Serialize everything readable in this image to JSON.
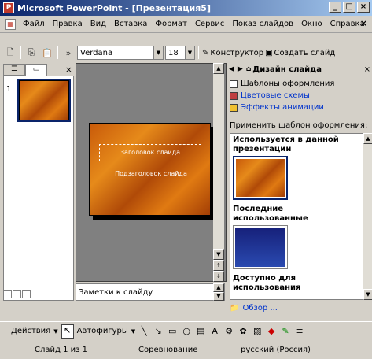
{
  "window": {
    "title": "Microsoft PowerPoint - [Презентация5]",
    "app_icon": "powerpoint-icon",
    "buttons": {
      "minimize": "_",
      "maximize": "□",
      "close": "×"
    }
  },
  "menu": {
    "items": [
      "Файл",
      "Правка",
      "Вид",
      "Вставка",
      "Формат",
      "Сервис",
      "Показ слайдов",
      "Окно",
      "Справка"
    ],
    "close": "×"
  },
  "toolbar": {
    "font_name": "Verdana",
    "font_size": "18",
    "constructor_label": "Конструктор",
    "new_slide_label": "Создать слайд"
  },
  "left_panel": {
    "close": "×",
    "slide_number": "1"
  },
  "slide": {
    "title_placeholder": "Заголовок слайда",
    "subtitle_placeholder": "Подзаголовок слайда"
  },
  "notes": {
    "placeholder": "Заметки к слайду"
  },
  "task_pane": {
    "title": "Дизайн слайда",
    "close": "×",
    "links": {
      "templates": "Шаблоны оформления",
      "color_schemes": "Цветовые схемы",
      "animation": "Эффекты анимации"
    },
    "apply_label": "Применить шаблон оформления:",
    "sections": {
      "used": "Используется в данной презентации",
      "recent": "Последние использованные",
      "available": "Доступно для использования"
    },
    "browse": "Обзор ..."
  },
  "draw_toolbar": {
    "actions": "Действия",
    "autoshapes": "Автофигуры"
  },
  "status": {
    "slide": "Слайд 1 из 1",
    "design": "Соревнование",
    "language": "русский (Россия)"
  },
  "colors": {
    "title_bar": "#0a246a",
    "slide_orange": "#e68a1a",
    "link": "#0033cc"
  }
}
